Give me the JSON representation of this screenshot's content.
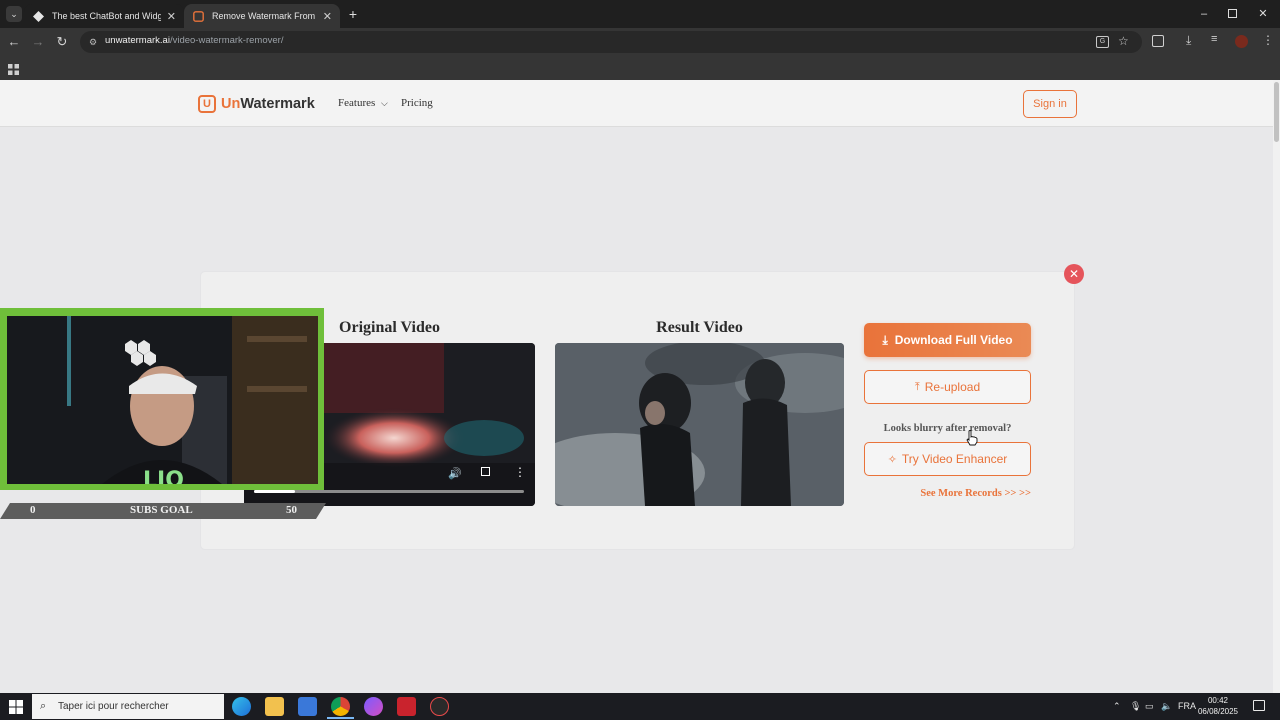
{
  "browser": {
    "tabs": [
      {
        "title": "The best ChatBot and Widgets",
        "active": false
      },
      {
        "title": "Remove Watermark From Video",
        "active": true
      }
    ],
    "url_domain": "unwatermark.ai",
    "url_path": "/video-watermark-remover/"
  },
  "site": {
    "logo_prefix": "Un",
    "logo_suffix": "Watermark",
    "logo_mark": "U",
    "nav": {
      "features": "Features",
      "pricing": "Pricing"
    },
    "signin": "Sign in"
  },
  "result": {
    "original_title": "Original Video",
    "result_title": "Result Video",
    "download_label": "Download Full Video",
    "reupload_label": "Re-upload",
    "blurry_text": "Looks blurry after removal?",
    "enhance_label": "Try Video Enhancer",
    "more_records": "See More Records >> >>",
    "video_progress": 0.15
  },
  "overlay": {
    "subs_start": "0",
    "subs_label": "SUBS GOAL",
    "subs_goal": "50"
  },
  "taskbar": {
    "search_placeholder": "Taper ici pour rechercher",
    "language": "FRA",
    "time": "00:42",
    "date": "06/08/2025"
  },
  "colors": {
    "accent": "#e9733a",
    "close": "#e5545b",
    "overlay_green": "#6fbf3a"
  }
}
